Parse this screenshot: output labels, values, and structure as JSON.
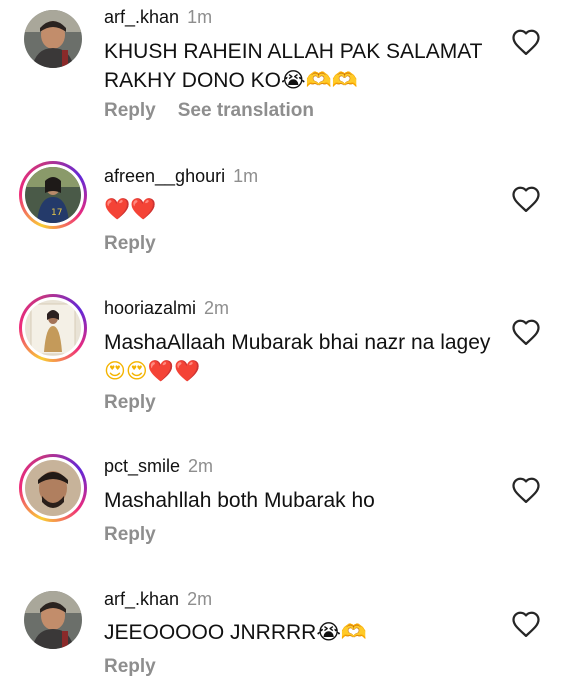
{
  "comments": [
    {
      "username": "arf_.khan",
      "time": "1m",
      "text": "KHUSH RAHEIN ALLAH PAK SALAMAT RAKHY DONO KO",
      "emojis": [
        "😭",
        "🫶",
        "🫶"
      ],
      "actions": {
        "reply": "Reply",
        "see_translation": "See translation"
      },
      "has_story_ring": false
    },
    {
      "username": "afreen__ghouri",
      "time": "1m",
      "text": "",
      "emojis": [
        "❤️",
        "❤️"
      ],
      "actions": {
        "reply": "Reply"
      },
      "has_story_ring": true
    },
    {
      "username": "hooriazalmi",
      "time": "2m",
      "text": "MashaAllaah Mubarak bhai nazr na lagey",
      "emojis": [
        "😍",
        "😍",
        "❤️",
        "❤️"
      ],
      "actions": {
        "reply": "Reply"
      },
      "has_story_ring": true
    },
    {
      "username": "pct_smile",
      "time": "2m",
      "text": "Mashahllah both Mubarak ho",
      "emojis": [],
      "actions": {
        "reply": "Reply"
      },
      "has_story_ring": true
    },
    {
      "username": "arf_.khan",
      "time": "2m",
      "text": "JEEOOOOO JNRRRR",
      "emojis": [
        "😭",
        "🫶"
      ],
      "actions": {
        "reply": "Reply"
      },
      "has_story_ring": false
    }
  ],
  "icons": {
    "like": "heart-outline-icon"
  },
  "colors": {
    "text": "#111111",
    "muted": "#8e8e8e",
    "story_ring_start": "#f9ce34",
    "story_ring_end": "#6228d7"
  }
}
